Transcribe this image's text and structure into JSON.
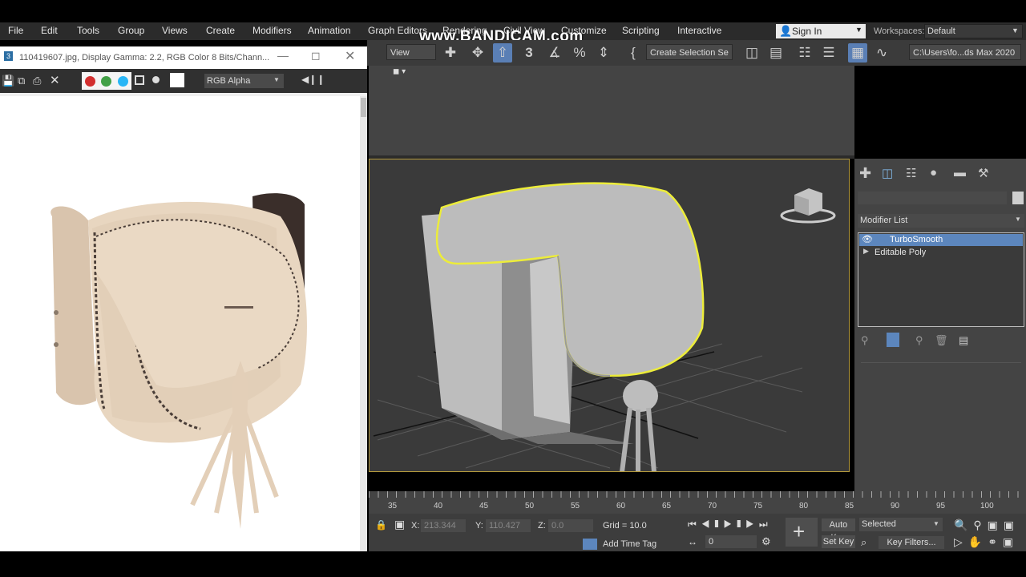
{
  "menu": {
    "items": [
      "File",
      "Edit",
      "Tools",
      "Group",
      "Views",
      "Create",
      "Modifiers",
      "Animation",
      "Graph Editors",
      "Rendering",
      "Civil View",
      "Customize",
      "Scripting",
      "Interactive"
    ],
    "sign_in": "Sign In",
    "workspaces_label": "Workspaces:",
    "workspace_value": "Default"
  },
  "watermark": "www.BANDICAM.com",
  "toolbar": {
    "view_dropdown": "View",
    "create_selection": "Create Selection Se",
    "path_field": "C:\\Users\\fo...ds Max 2020"
  },
  "image_window": {
    "title": "110419607.jpg, Display Gamma: 2.2, RGB Color 8 Bits/Chann...",
    "channel_dropdown": "RGB Alpha",
    "channel_colors": [
      "#d32f2f",
      "#43a047",
      "#29b6f6"
    ]
  },
  "command_panel": {
    "modifier_list_label": "Modifier List",
    "stack": [
      "TurboSmooth",
      "Editable Poly"
    ]
  },
  "timeline": {
    "ticks": [
      "35",
      "40",
      "45",
      "50",
      "55",
      "60",
      "65",
      "70",
      "75",
      "80",
      "85",
      "90",
      "95",
      "100"
    ]
  },
  "status": {
    "x_label": "X:",
    "x_value": "213.344",
    "y_label": "Y:",
    "y_value": "110.427",
    "z_label": "Z:",
    "z_value": "0.0",
    "grid": "Grid = 10.0",
    "add_time_tag": "Add Time Tag",
    "auto_key": "Auto Key",
    "selected": "Selected",
    "set_key": "Set Key",
    "key_filters": "Key Filters...",
    "frame": "0"
  }
}
